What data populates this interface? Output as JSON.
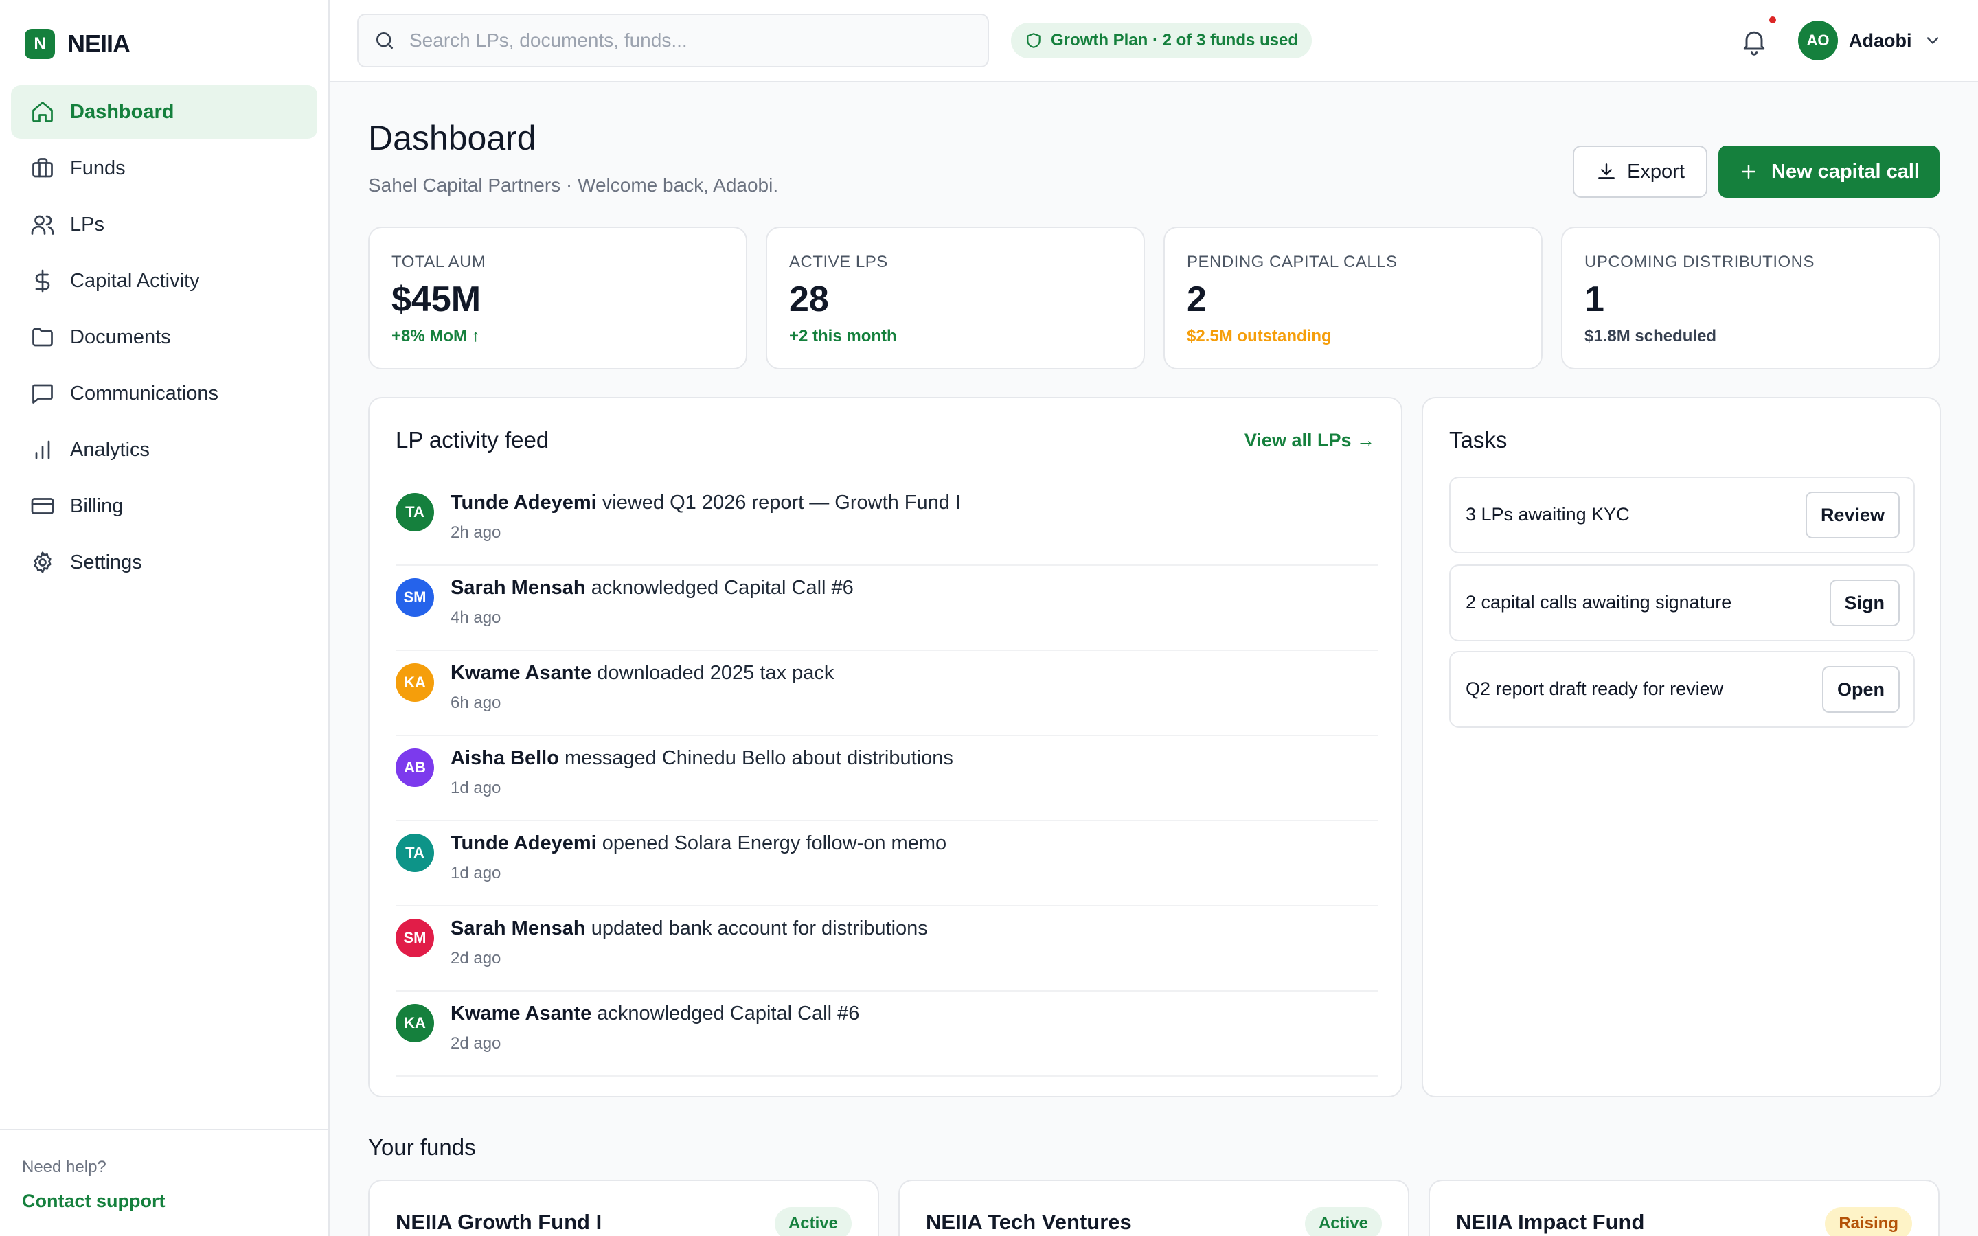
{
  "brand": {
    "mark": "N",
    "name": "NEIIA"
  },
  "sidebar": {
    "items": [
      {
        "label": "Dashboard",
        "icon": "home-icon",
        "active": true
      },
      {
        "label": "Funds",
        "icon": "briefcase-icon"
      },
      {
        "label": "LPs",
        "icon": "users-icon"
      },
      {
        "label": "Capital Activity",
        "icon": "dollar-icon"
      },
      {
        "label": "Documents",
        "icon": "folder-icon"
      },
      {
        "label": "Communications",
        "icon": "message-icon"
      },
      {
        "label": "Analytics",
        "icon": "bar-chart-icon"
      },
      {
        "label": "Billing",
        "icon": "credit-card-icon"
      },
      {
        "label": "Settings",
        "icon": "gear-icon"
      }
    ],
    "help_text": "Need help?",
    "support_link": "Contact support"
  },
  "topbar": {
    "search_placeholder": "Search LPs, documents, funds...",
    "plan_badge": "Growth Plan · 2 of 3 funds used",
    "user_initials": "AO",
    "user_name": "Adaobi"
  },
  "page": {
    "title": "Dashboard",
    "subtitle": "Sahel Capital Partners · Welcome back, Adaobi.",
    "export_label": "Export",
    "primary_label": "New capital call"
  },
  "stats": [
    {
      "label": "TOTAL AUM",
      "value": "$45M",
      "note": "+8% MoM ↑",
      "note_color": "#15803d"
    },
    {
      "label": "ACTIVE LPS",
      "value": "28",
      "note": "+2 this month",
      "note_color": "#15803d"
    },
    {
      "label": "PENDING CAPITAL CALLS",
      "value": "2",
      "note": "$2.5M outstanding",
      "note_color": "#f59e0b"
    },
    {
      "label": "UPCOMING DISTRIBUTIONS",
      "value": "1",
      "note": "$1.8M scheduled",
      "note_color": "#374151"
    }
  ],
  "feed": {
    "title": "LP activity feed",
    "view_all": "View all LPs →",
    "items": [
      {
        "initials": "TA",
        "color": "#15803d",
        "name": "Tunde Adeyemi",
        "action": "viewed Q1 2026 report — Growth Fund I",
        "time": "2h ago"
      },
      {
        "initials": "SM",
        "color": "#2563eb",
        "name": "Sarah Mensah",
        "action": "acknowledged Capital Call #6",
        "time": "4h ago"
      },
      {
        "initials": "KA",
        "color": "#f59e0b",
        "name": "Kwame Asante",
        "action": "downloaded 2025 tax pack",
        "time": "6h ago"
      },
      {
        "initials": "AB",
        "color": "#7c3aed",
        "name": "Aisha Bello",
        "action": "messaged Chinedu Bello about distributions",
        "time": "1d ago"
      },
      {
        "initials": "TA",
        "color": "#0d9488",
        "name": "Tunde Adeyemi",
        "action": "opened Solara Energy follow-on memo",
        "time": "1d ago"
      },
      {
        "initials": "SM",
        "color": "#e11d48",
        "name": "Sarah Mensah",
        "action": "updated bank account for distributions",
        "time": "2d ago"
      },
      {
        "initials": "KA",
        "color": "#15803d",
        "name": "Kwame Asante",
        "action": "acknowledged Capital Call #6",
        "time": "2d ago"
      }
    ]
  },
  "tasks": {
    "title": "Tasks",
    "items": [
      {
        "label": "3 LPs awaiting KYC",
        "button": "Review"
      },
      {
        "label": "2 capital calls awaiting signature",
        "button": "Sign"
      },
      {
        "label": "Q2 report draft ready for review",
        "button": "Open"
      }
    ]
  },
  "funds": {
    "title": "Your funds",
    "items": [
      {
        "name": "NEIIA Growth Fund I",
        "status": "Active",
        "status_bg": "#e8f5ec",
        "status_color": "#15803d"
      },
      {
        "name": "NEIIA Tech Ventures",
        "status": "Active",
        "status_bg": "#e8f5ec",
        "status_color": "#15803d"
      },
      {
        "name": "NEIIA Impact Fund",
        "status": "Raising",
        "status_bg": "#fef3c7",
        "status_color": "#b45309"
      }
    ]
  },
  "colors": {
    "accent": "#15803d",
    "notification": "#dc2626"
  }
}
